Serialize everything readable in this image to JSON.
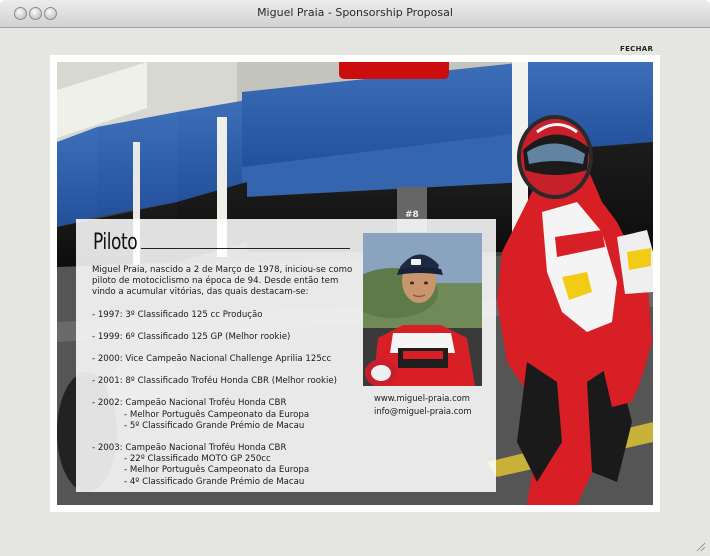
{
  "window": {
    "title": "Miguel Praia - Sponsorship Proposal"
  },
  "nav": {
    "close_label": "FECHAR"
  },
  "bio": {
    "heading": "Piloto",
    "intro": "Miguel Praia, nascido a 2 de Março de 1978, iniciou-se como piloto de motociclismo na época de 94. Desde então tem vindo a acumular vitórias, das quais destacam-se:",
    "entries": [
      {
        "main": "- 1997: 3º Classificado 125 cc Produção",
        "subs": []
      },
      {
        "main": "- 1999: 6º Classificado 125 GP (Melhor rookie)",
        "subs": []
      },
      {
        "main": "- 2000: Vice Campeão Nacional Challenge Aprilia 125cc",
        "subs": []
      },
      {
        "main": "- 2001: 8º Classificado Troféu Honda CBR (Melhor rookie)",
        "subs": []
      },
      {
        "main": "- 2002: Campeão Nacional Troféu Honda CBR",
        "subs": [
          "- Melhor Português Campeonato da Europa",
          "- 5º Classificado Grande Prémio de Macau"
        ]
      },
      {
        "main": "- 2003: Campeão Nacional Troféu Honda CBR",
        "subs": [
          "- 22º Classificado MOTO GP 250cc",
          "- Melhor Português Campeonato da Europa",
          "- 4º Classificado Grande Prémio de Macau"
        ]
      }
    ]
  },
  "contact": {
    "website": "www.miguel-praia.com",
    "email": "info@miguel-praia.com"
  },
  "photo": {
    "logo_text": "#8"
  },
  "colors": {
    "accent_red": "#cc0d0d",
    "garage_blue": "#2e5fa8",
    "window_bg": "#e5e5e2"
  }
}
